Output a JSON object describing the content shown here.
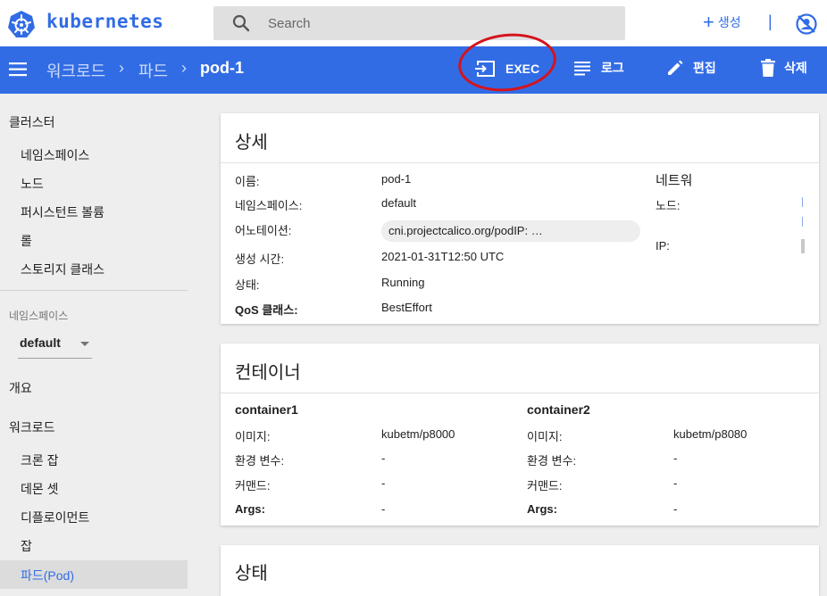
{
  "header": {
    "brand": "kubernetes",
    "search_placeholder": "Search",
    "create_label": "생성",
    "separator": "|"
  },
  "breadcrumb": {
    "items": [
      "워크로드",
      "파드",
      "pod-1"
    ],
    "separator": "›"
  },
  "actions": {
    "exec": "EXEC",
    "logs": "로그",
    "edit": "편집",
    "delete": "삭제"
  },
  "sidebar": {
    "cluster_header": "클러스터",
    "cluster_items": [
      "네임스페이스",
      "노드",
      "퍼시스턴트 볼륨",
      "롤",
      "스토리지 클래스"
    ],
    "namespace_section": "네임스페이스",
    "namespace_value": "default",
    "overview": "개요",
    "workloads_header": "워크로드",
    "workload_items": [
      "크론 잡",
      "데몬 셋",
      "디플로이먼트",
      "잡",
      "파드(Pod)"
    ]
  },
  "details": {
    "title": "상세",
    "rows": [
      {
        "label": "이름:",
        "value": "pod-1"
      },
      {
        "label": "네임스페이스:",
        "value": "default"
      },
      {
        "label": "어노테이션:",
        "value": "cni.projectcalico.org/podIP:  …"
      },
      {
        "label": "생성 시간:",
        "value": "2021-01-31T12:50 UTC"
      },
      {
        "label": "상태:",
        "value": "Running"
      },
      {
        "label": "QoS 클래스:",
        "value": "BestEffort"
      }
    ],
    "network_title": "네트워",
    "node_label": "노드:",
    "ip_label": "IP:"
  },
  "containers": {
    "title": "컨테이너",
    "list": [
      {
        "name": "container1",
        "image_label": "이미지:",
        "image": "kubetm/p8000",
        "env_label": "환경 변수:",
        "env": "-",
        "cmd_label": "커맨드:",
        "cmd": "-",
        "args_label": "Args:",
        "args": "-"
      },
      {
        "name": "container2",
        "image_label": "이미지:",
        "image": "kubetm/p8080",
        "env_label": "환경 변수:",
        "env": "-",
        "cmd_label": "커맨드:",
        "cmd": "-",
        "args_label": "Args:",
        "args": "-"
      }
    ]
  },
  "status_card": {
    "title": "상태"
  },
  "colors": {
    "primary": "#326ce5",
    "annotation_circle": "#d5131c"
  }
}
